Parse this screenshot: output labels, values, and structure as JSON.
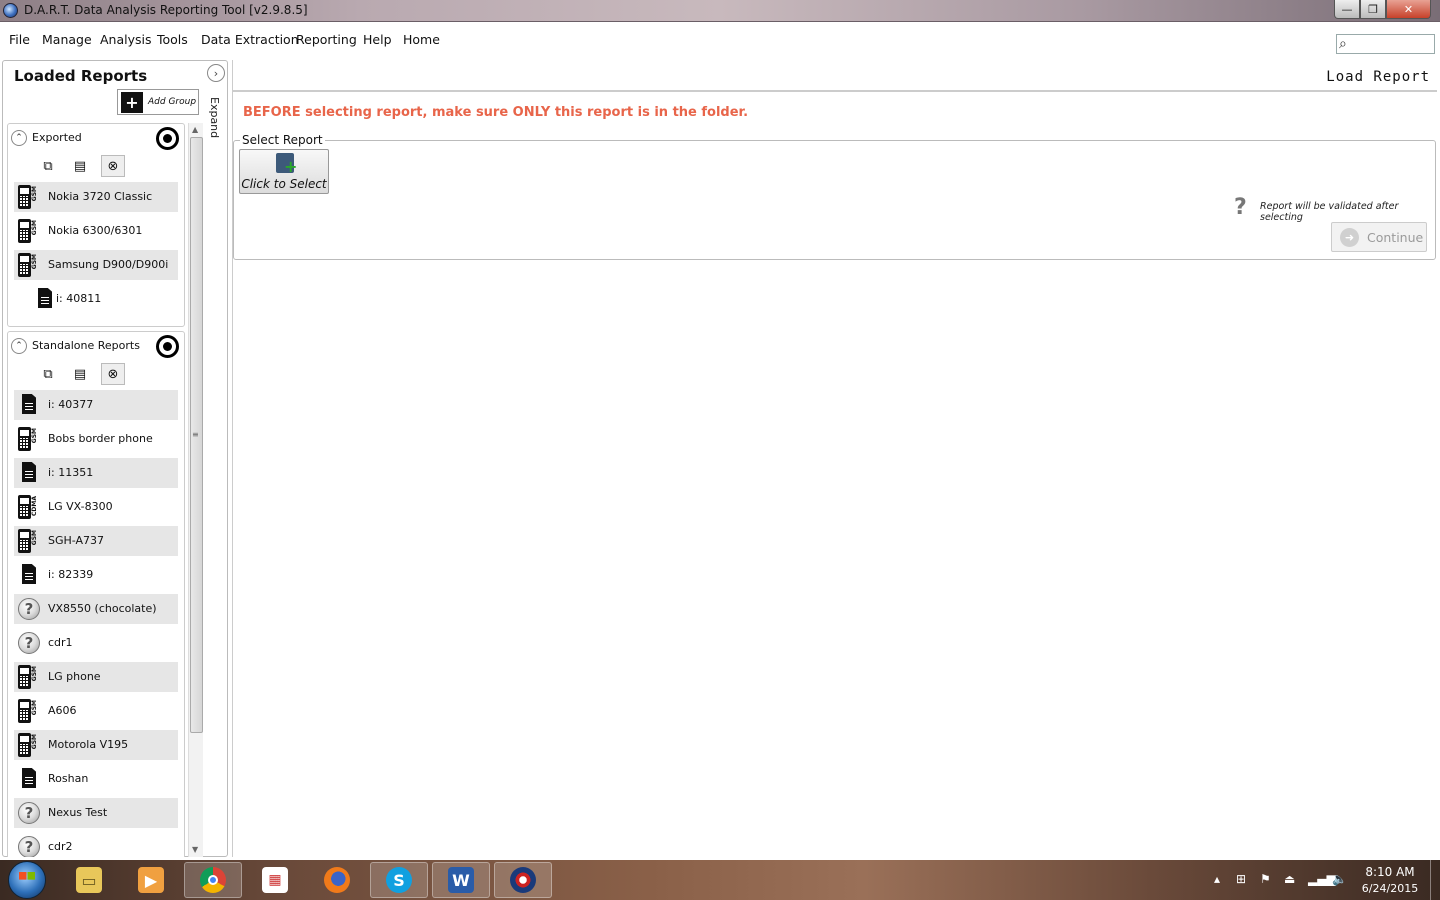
{
  "window": {
    "title": "D.A.R.T. Data Analysis Reporting Tool [v2.9.8.5]",
    "min": "—",
    "max": "❐",
    "close": "✕"
  },
  "menu": [
    "File",
    "Manage",
    "Analysis",
    "Tools",
    "Data Extraction",
    "Reporting",
    "Help",
    "Home"
  ],
  "sidebar": {
    "title": "Loaded Reports",
    "expand_label": "Expand",
    "add_group_label": "Add Group",
    "groups": [
      {
        "name": "Exported",
        "devices": [
          {
            "label": "Nokia 3720 Classic",
            "icon": "phone-gsm-icon",
            "tag": "GSM"
          },
          {
            "label": "Nokia 6300/6301",
            "icon": "phone-gsm-icon",
            "tag": "GSM"
          },
          {
            "label": "Samsung D900/D900i",
            "icon": "phone-gsm-icon",
            "tag": "GSM"
          },
          {
            "label": "i: 40811",
            "icon": "sim-card-icon",
            "tag": ""
          }
        ]
      },
      {
        "name": "Standalone Reports",
        "devices": [
          {
            "label": "i: 40377",
            "icon": "sim-card-icon",
            "tag": ""
          },
          {
            "label": "Bobs border phone",
            "icon": "phone-gsm-icon",
            "tag": "GSM"
          },
          {
            "label": "i: 11351",
            "icon": "sim-card-icon",
            "tag": ""
          },
          {
            "label": "LG VX-8300",
            "icon": "phone-cdma-icon",
            "tag": "CDMA"
          },
          {
            "label": "SGH-A737",
            "icon": "phone-gsm-icon",
            "tag": "GSM"
          },
          {
            "label": "i: 82339",
            "icon": "sim-card-icon",
            "tag": ""
          },
          {
            "label": "VX8550 (chocolate)",
            "icon": "unknown-device-icon",
            "tag": ""
          },
          {
            "label": "cdr1",
            "icon": "unknown-device-icon",
            "tag": ""
          },
          {
            "label": "LG phone",
            "icon": "phone-gsm-icon",
            "tag": "GSM"
          },
          {
            "label": "A606",
            "icon": "phone-gsm-icon",
            "tag": "GSM"
          },
          {
            "label": "Motorola V195",
            "icon": "phone-gsm-icon",
            "tag": "GSM"
          },
          {
            "label": "Roshan",
            "icon": "sim-card-icon",
            "tag": ""
          },
          {
            "label": "Nexus Test",
            "icon": "unknown-device-icon",
            "tag": ""
          },
          {
            "label": "cdr2",
            "icon": "unknown-device-icon",
            "tag": ""
          }
        ]
      }
    ]
  },
  "main": {
    "title": "Load Report",
    "warning": "BEFORE selecting report, make sure ONLY this report is in the folder.",
    "select_legend": "Select Report",
    "click_select_label": "Click to Select",
    "validate_note": "Report will be validated after selecting",
    "continue_label": "Continue"
  },
  "colors": {
    "warning": "#e8654a",
    "disabled_text": "#9a9a9a"
  },
  "taskbar": {
    "apps": [
      "file-explorer-icon",
      "media-player-icon",
      "chrome-icon",
      "apps-grid-icon",
      "firefox-icon",
      "skype-icon",
      "word-icon",
      "dart-icon"
    ],
    "time": "8:10 AM",
    "date": "6/24/2015"
  }
}
